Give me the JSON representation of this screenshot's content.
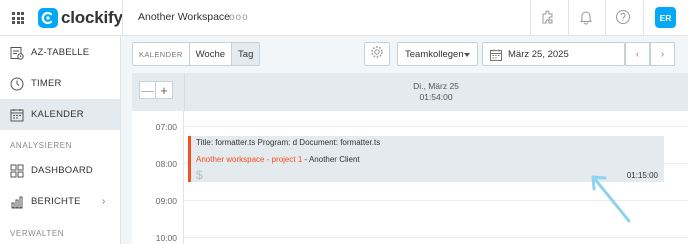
{
  "header": {
    "app_name": "clockify",
    "workspace": "Another Workspace",
    "more": "ooo",
    "avatar_initials": "ER",
    "brand_color": "#03a9f4",
    "icons": [
      "apps-grid-icon",
      "puzzle-icon",
      "bell-icon",
      "help-icon"
    ]
  },
  "sidebar": {
    "items": [
      {
        "label": "AZ-TABELLE",
        "icon": "timesheet-icon"
      },
      {
        "label": "TIMER",
        "icon": "clock-icon"
      },
      {
        "label": "KALENDER",
        "icon": "calendar-icon",
        "active": true
      }
    ],
    "section_analyze": "ANALYSIEREN",
    "analyze_items": [
      {
        "label": "DASHBOARD",
        "icon": "dashboard-icon"
      },
      {
        "label": "BERICHTE",
        "icon": "bar-chart-icon",
        "chevron": "›"
      }
    ],
    "section_manage": "VERWALTEN"
  },
  "toolbar": {
    "view_label": "KALENDER",
    "views": [
      "Woche",
      "Tag"
    ],
    "selected_view": "Tag",
    "team_select": "Teamkollegen",
    "date": "März 25, 2025",
    "prev": "‹",
    "next": "›"
  },
  "calendar": {
    "zoom_out": "—",
    "zoom_in": "+",
    "day_label": "Di., März 25",
    "day_total": "01:54:00",
    "hours": [
      "07:00",
      "08:00",
      "09:00",
      "10:00"
    ],
    "event": {
      "title": "Title: formatter.ts Program: d Document: formatter.ts",
      "project": "Another workspace - project 1",
      "separator": " - ",
      "client": "Another Client",
      "billable": "$",
      "duration": "01:15:00",
      "color": "#f4511e"
    }
  }
}
